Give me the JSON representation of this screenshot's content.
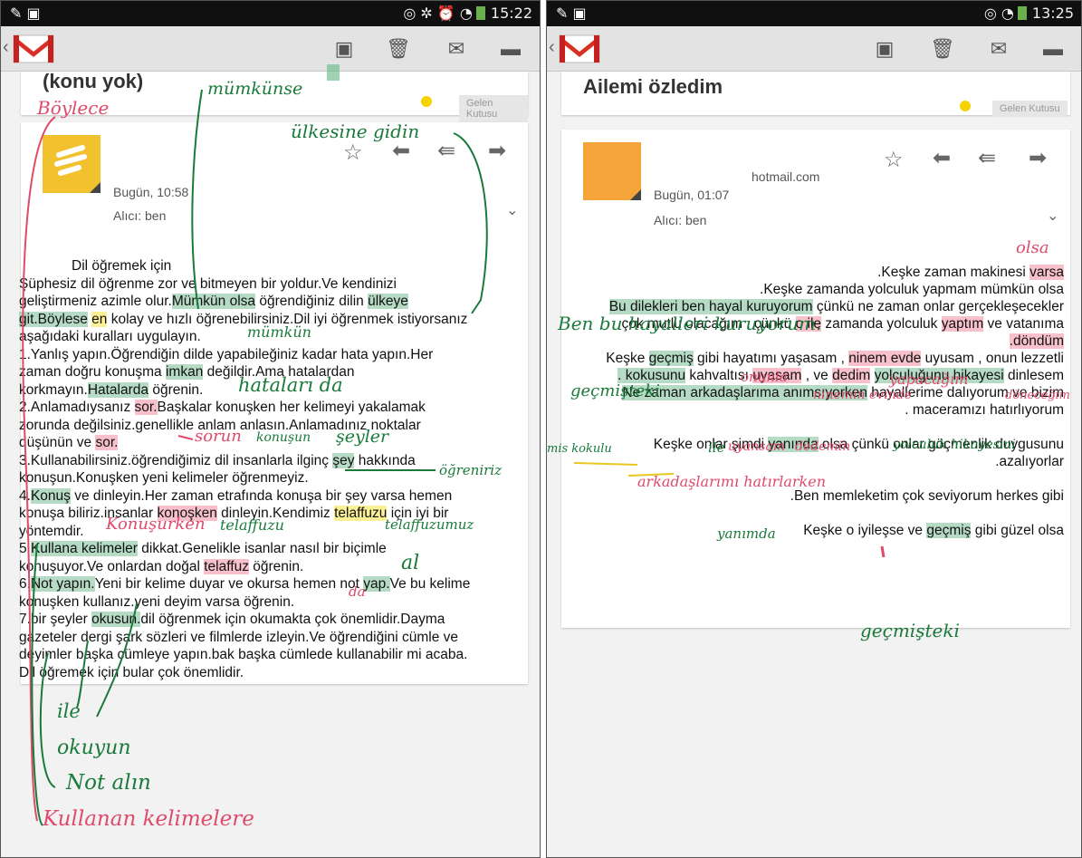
{
  "left": {
    "status": {
      "time": "15:22"
    },
    "subject": "(konu yok)",
    "label": "Gelen Kutusu",
    "date": "Bugün, 10:58",
    "to": "Alıcı: ben",
    "body_title": "Dil öğremek için",
    "body_lines": [
      [
        "Şüphesiz dil öğrenme zor ve bitmeyen bir yoldur.Ve kendinizi"
      ],
      [
        "geliştirmeniz azimle olur.",
        {
          "t": "Mümkün olsa",
          "h": "g"
        },
        " öğrendiğiniz dilin ",
        {
          "t": "ülkeye",
          "h": "g"
        }
      ],
      [
        {
          "t": "git.Böylese",
          "h": "g"
        },
        " ",
        {
          "t": "en",
          "h": "y"
        },
        " kolay ve hızlı öğrenebilirsiniz.Dil iyi öğrenmek istiyorsanız"
      ],
      [
        "aşağıdaki kuralları uygulayın."
      ],
      [
        "1.Yanlış yapın.Öğrendiğin dilde yapabileğiniz kadar hata yapın.Her"
      ],
      [
        "zaman doğru konuşma ",
        {
          "t": "imkan",
          "h": "g"
        },
        " değildir.Ama hatalardan"
      ],
      [
        "korkmayın.",
        {
          "t": "Hatalarda",
          "h": "g"
        },
        " öğrenin."
      ],
      [
        "2.Anlamadıysanız ",
        {
          "t": "sor.",
          "h": "p"
        },
        "Başkalar konuşken her kelimeyi yakalamak"
      ],
      [
        "zorunda değilsiniz.genellikle anlam anlasın.Anlamadınız noktalar"
      ],
      [
        "düşünün ve ",
        {
          "t": "sor.",
          "h": "p"
        }
      ],
      [
        "3.Kullanabilirsiniz.öğrendiğimiz dil insanlarla ilginç ",
        {
          "t": "şey",
          "h": "g"
        },
        " hakkında"
      ],
      [
        "konuşun.Konuşken yeni kelimeler öğrenmeyiz."
      ],
      [
        "4.",
        {
          "t": "Konuş",
          "h": "g"
        },
        " ve dinleyin.Her zaman etrafında konuşa bir şey varsa hemen"
      ],
      [
        "konuşa biliriz.insanlar ",
        {
          "t": "konoşken",
          "h": "p"
        },
        " dinleyin.Kendimiz ",
        {
          "t": "telaffuzu",
          "h": "y"
        },
        " için iyi bir"
      ],
      [
        "yöntemdir."
      ],
      [
        "5.",
        {
          "t": "Kullana kelimeler",
          "h": "g"
        },
        " dikkat.Genelikle isanlar nasıl bir biçimle"
      ],
      [
        "konuşuyor.Ve onlardan doğal ",
        {
          "t": "telaffuz",
          "h": "p"
        },
        " öğrenin."
      ],
      [
        "6.",
        {
          "t": "Not yapın.",
          "h": "g"
        },
        "Yeni bir kelime duyar ve okursa hemen not ",
        {
          "t": "yap.",
          "h": "g"
        },
        "Ve bu kelime"
      ],
      [
        "konuşken kullanız.yeni deyim varsa öğrenin."
      ],
      [
        "7.bir şeyler ",
        {
          "t": "okusun.",
          "h": "g"
        },
        "dil öğrenmek için okumakta çok önemlidir.Dayma"
      ],
      [
        "gazeteler dergi şark sözleri ve filmlerde izleyin.Ve öğrendiğini cümle ve"
      ],
      [
        "deyimler başka cümleye yapın.bak başka cümlede kullanabilir mi acaba."
      ],
      [
        "Dil öğremek için bular çok önemlidir."
      ]
    ],
    "notes": [
      "mümkünse",
      "Böylece",
      "ülkesine gidin",
      "mümkün",
      "hataları da",
      "sorun",
      "konuşun",
      "şeyler",
      "öğreniriz",
      "Konuşurken",
      "telaffuzu",
      "telaffuzumuz",
      "al",
      "da",
      "ile",
      "okuyun",
      "Not alın",
      "Kullanan kelimelere"
    ]
  },
  "right": {
    "status": {
      "time": "13:25"
    },
    "subject": "Ailemi özledim",
    "label": "Gelen Kutusu",
    "sender": "hotmail.com",
    "date": "Bugün, 01:07",
    "to": "Alıcı: ben",
    "body_lines": [
      [
        ".Keşke zaman makinesi ",
        {
          "t": "varsa",
          "h": "p"
        }
      ],
      [
        ".Keşke zamanda yolculuk yapmam mümkün olsa"
      ],
      [
        {
          "t": "Bu dilekleri ben hayal kuruyorum",
          "h": "g"
        },
        " çünkü ne zaman onlar gerçekleşecekler"
      ],
      [
        "çok mutlu olacağım , çünkü ",
        {
          "t": "o ile",
          "h": "p"
        },
        " zamanda yolculuk ",
        {
          "t": "yaptım",
          "h": "p"
        },
        " ve vatanıma"
      ],
      [
        {
          "t": ".döndüm",
          "h": "p"
        }
      ],
      [
        "Keşke ",
        {
          "t": "geçmiş",
          "h": "g"
        },
        " gibi hayatımı yaşasam , ",
        {
          "t": "ninem evde",
          "h": "p"
        },
        " uyusam , onun lezzetli"
      ],
      [
        {
          "t": ". kokusunu",
          "h": "g"
        },
        " kahvaltısı ",
        {
          "t": "uyasam",
          "h": "p"
        },
        " , ve ",
        {
          "t": "dedim",
          "h": "p"
        },
        " ",
        {
          "t": "yolculuğunu hikayesi",
          "h": "g"
        },
        " dinlesem"
      ],
      [
        {
          "t": "Ne zaman arkadaşlarıma anımsıyorken",
          "h": "g"
        },
        " hayallerime dalıyorum ve bizim"
      ],
      [
        ". maceramızı hatırlıyorum"
      ],
      [
        ""
      ],
      [
        "Keşke onlar şimdi ",
        {
          "t": "yanında",
          "h": "g"
        },
        " olsa çünkü onlar göçmenlik duygusunu"
      ],
      [
        ".azalıyorlar"
      ],
      [
        ""
      ],
      [
        ".Ben memleketim çok seviyorum herkes gibi"
      ],
      [
        ""
      ],
      [
        "Keşke o iyileşse ve ",
        {
          "t": "geçmiş",
          "h": "g"
        },
        " gibi güzel olsa"
      ]
    ],
    "notes": [
      "olsa",
      "Ben bu hayalleri kuruyorum.",
      "geçmişteki",
      "onunla",
      "yapacağım",
      "döneceğim",
      "ninemin evinde",
      "mis kokulu",
      "ile",
      "uyansam",
      "dedemin",
      "yolculuk hikayesini",
      "arkadaşlarımı hatırlarken",
      "yanımda",
      "geçmişteki"
    ]
  }
}
